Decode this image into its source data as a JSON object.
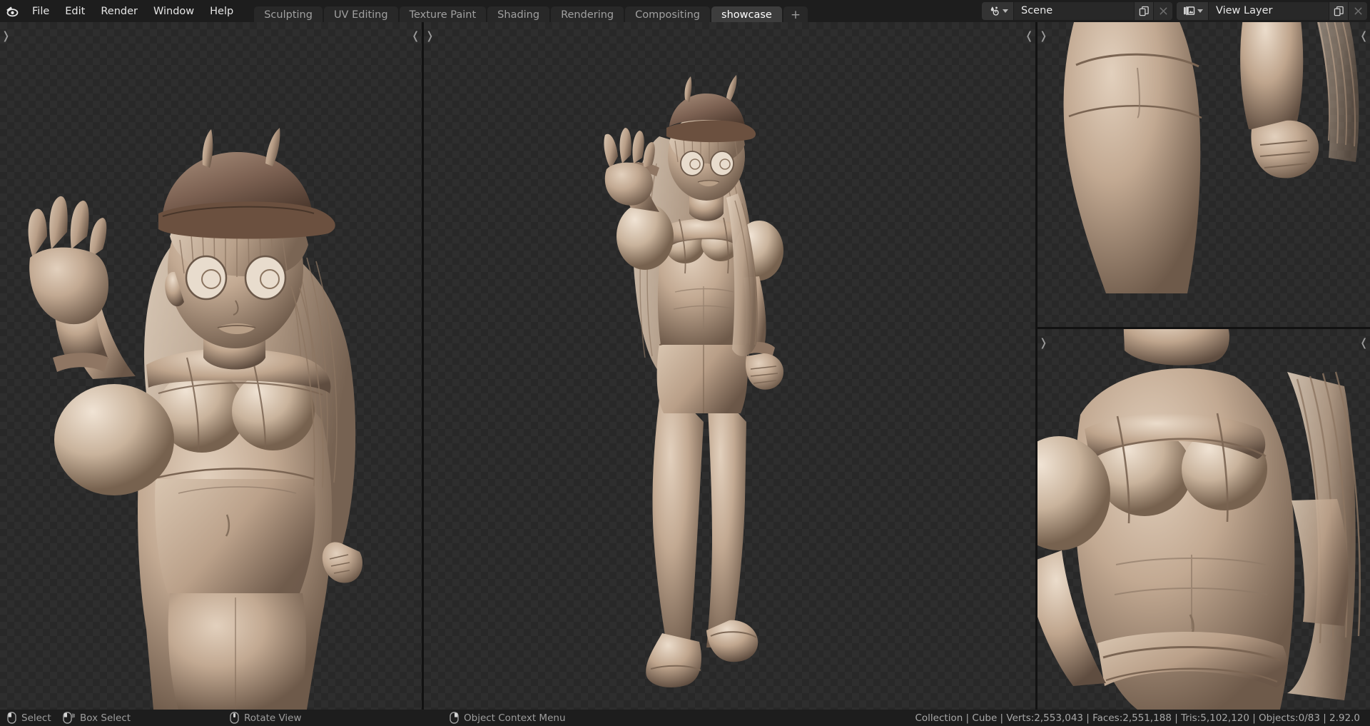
{
  "app": {
    "name": "Blender",
    "version_status": "2.92.0",
    "logo_icon": "blender-logo-icon"
  },
  "topbar": {
    "menus": [
      {
        "label": "File",
        "name": "menu-file"
      },
      {
        "label": "Edit",
        "name": "menu-edit"
      },
      {
        "label": "Render",
        "name": "menu-render"
      },
      {
        "label": "Window",
        "name": "menu-window"
      },
      {
        "label": "Help",
        "name": "menu-help"
      }
    ],
    "workspace_tabs": [
      {
        "label": "Sculpting",
        "active": false
      },
      {
        "label": "UV Editing",
        "active": false
      },
      {
        "label": "Texture Paint",
        "active": false
      },
      {
        "label": "Shading",
        "active": false
      },
      {
        "label": "Rendering",
        "active": false
      },
      {
        "label": "Compositing",
        "active": false
      },
      {
        "label": "showcase",
        "active": true
      }
    ],
    "add_workspace_label": "+",
    "scene": {
      "icon": "scene-icon",
      "name": "Scene",
      "new_button_icon": "duplicate-icon",
      "unlink_button_icon": "close-x-icon"
    },
    "view_layer": {
      "icon": "view-layer-icon",
      "name": "View Layer",
      "new_button_icon": "duplicate-icon",
      "unlink_button_icon": "close-x-icon"
    }
  },
  "viewports": [
    {
      "name": "viewport-left-quarter-view",
      "label": "3D Viewport"
    },
    {
      "name": "viewport-center-full-body",
      "label": "3D Viewport"
    },
    {
      "name": "viewport-top-right-detail-legs",
      "label": "3D Viewport"
    },
    {
      "name": "viewport-bottom-right-detail-torso",
      "label": "3D Viewport"
    }
  ],
  "statusbar": {
    "hints": [
      {
        "icon": "mouse-left-click-icon",
        "label": "Select"
      },
      {
        "icon": "mouse-left-drag-icon",
        "label": "Box Select"
      },
      {
        "icon": "mouse-middle-click-icon",
        "label": "Rotate View"
      },
      {
        "icon": "mouse-right-click-icon",
        "label": "Object Context Menu"
      }
    ],
    "scene_stats": "Collection | Cube | Verts:2,553,043 | Faces:2,551,188 | Tris:5,102,120 | Objects:0/83 | 2.92.0",
    "stats": {
      "collection": "Collection",
      "active_object": "Cube",
      "verts": "Verts:2,553,043",
      "faces": "Faces:2,551,188",
      "tris": "Tris:5,102,120",
      "objects": "Objects:0/83",
      "version": "2.92.0"
    }
  },
  "colors": {
    "window_bg": "#1d1d1d",
    "tab_active": "#3d3d3d",
    "tab_inactive": "#282828",
    "checker_light": "#2e2e2e",
    "checker_dark": "#282828",
    "clay_material": "#c4ac96",
    "clay_shadow": "#6f5b4c",
    "hat_material": "#7d6253",
    "text_primary": "#e5e5e5",
    "text_dim": "#9d9d9d"
  }
}
